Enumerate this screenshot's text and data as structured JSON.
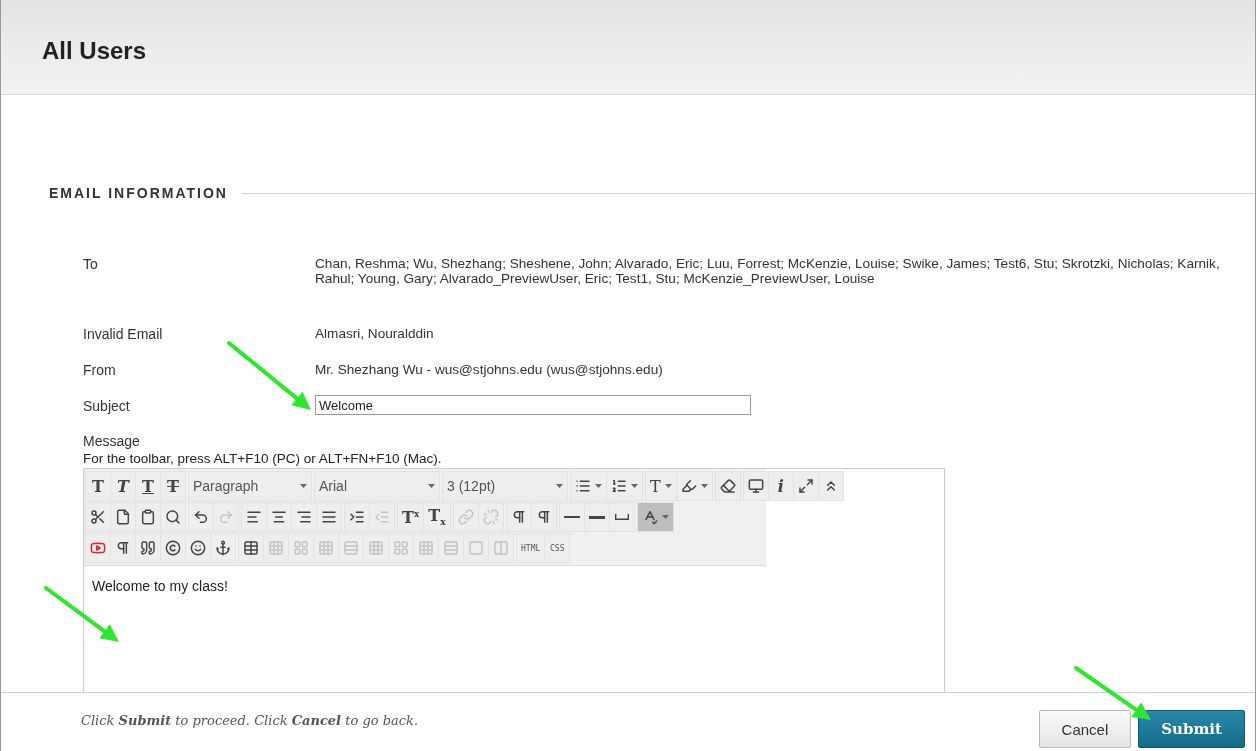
{
  "page": {
    "title": "All Users"
  },
  "section": {
    "title": "EMAIL INFORMATION"
  },
  "fields": [
    {
      "kind": "text",
      "label": "To",
      "value": "Chan, Reshma; Wu, Shezhang; Sheshene, John; Alvarado, Eric; Luu, Forrest; McKenzie, Louise; Swike, James; Test6, Stu; Skrotzki, Nicholas; Karnik, Rahul; Young, Gary; Alvarado_PreviewUser, Eric; Test1, Stu; McKenzie_PreviewUser, Louise"
    },
    {
      "kind": "text",
      "label": "Invalid Email",
      "value": "Almasri, Nouralddin"
    },
    {
      "kind": "text",
      "label": "From",
      "value": "Mr. Shezhang Wu - wus@stjohns.edu (wus@stjohns.edu)"
    },
    {
      "kind": "input",
      "label": "Subject",
      "value": "Welcome"
    }
  ],
  "message": {
    "label": "Message",
    "hint": "For the toolbar, press ALT+F10 (PC) or ALT+FN+F10 (Mac).",
    "body": "Welcome to my class!"
  },
  "toolbar": {
    "rows": [
      [
        {
          "items": [
            {
              "kind": "glyph",
              "label": "T",
              "disabled": false
            },
            {
              "kind": "glyph",
              "label": "T",
              "disabled": false
            },
            {
              "kind": "glyph",
              "label": "T",
              "disabled": false
            },
            {
              "kind": "glyph",
              "label": "T",
              "disabled": false
            }
          ]
        },
        {
          "items": [
            {
              "kind": "select",
              "label": "Paragraph"
            }
          ]
        },
        {
          "items": [
            {
              "kind": "select",
              "label": "Arial"
            }
          ]
        },
        {
          "items": [
            {
              "kind": "select",
              "label": "3 (12pt)"
            }
          ]
        },
        {
          "items": [
            {
              "kind": "split-icon",
              "disabled": false
            },
            {
              "kind": "split-icon",
              "disabled": false
            }
          ]
        },
        {
          "items": [
            {
              "kind": "split-glyph",
              "label": "T",
              "disabled": false
            },
            {
              "kind": "split-icon",
              "disabled": false
            }
          ]
        },
        {
          "items": [
            {
              "kind": "icon",
              "disabled": false
            }
          ]
        },
        {
          "items": [
            {
              "kind": "icon",
              "disabled": false
            },
            {
              "kind": "glyph",
              "label": "i",
              "disabled": false
            },
            {
              "kind": "icon",
              "disabled": false
            },
            {
              "kind": "icon",
              "disabled": false
            }
          ]
        }
      ],
      [
        {
          "items": [
            {
              "kind": "icon",
              "disabled": false
            },
            {
              "kind": "icon",
              "disabled": false
            },
            {
              "kind": "icon",
              "disabled": false
            },
            {
              "kind": "icon",
              "disabled": false
            }
          ]
        },
        {
          "items": [
            {
              "kind": "icon",
              "disabled": false
            },
            {
              "kind": "icon",
              "disabled": true
            }
          ]
        },
        {
          "items": [
            {
              "kind": "icon",
              "disabled": false
            },
            {
              "kind": "icon",
              "disabled": false
            },
            {
              "kind": "icon",
              "disabled": false
            },
            {
              "kind": "icon",
              "disabled": false
            }
          ]
        },
        {
          "items": [
            {
              "kind": "icon",
              "disabled": false
            },
            {
              "kind": "icon",
              "disabled": true
            }
          ]
        },
        {
          "items": [
            {
              "kind": "glyph",
              "label": "T$^{x}$",
              "disabled": false
            },
            {
              "kind": "glyph",
              "label": "T$_{x}$",
              "disabled": false
            }
          ]
        },
        {
          "items": [
            {
              "kind": "icon",
              "disabled": true
            },
            {
              "kind": "icon",
              "disabled": true
            }
          ]
        },
        {
          "items": [
            {
              "kind": "icon",
              "disabled": false
            },
            {
              "kind": "icon",
              "disabled": false
            }
          ]
        },
        {
          "items": [
            {
              "kind": "icon",
              "disabled": false
            },
            {
              "kind": "icon",
              "disabled": false
            },
            {
              "kind": "icon",
              "disabled": false
            }
          ]
        },
        {
          "items": [
            {
              "kind": "split-icon",
              "disabled": false,
              "pressed": true
            }
          ]
        }
      ],
      [
        {
          "items": [
            {
              "kind": "icon",
              "disabled": false
            },
            {
              "kind": "icon",
              "disabled": false
            },
            {
              "kind": "icon",
              "disabled": false
            },
            {
              "kind": "icon",
              "disabled": false
            },
            {
              "kind": "icon",
              "disabled": false
            },
            {
              "kind": "icon",
              "disabled": false
            }
          ]
        },
        {
          "items": [
            {
              "kind": "icon",
              "disabled": false
            },
            {
              "kind": "icon",
              "disabled": true
            },
            {
              "kind": "icon",
              "disabled": true
            },
            {
              "kind": "icon",
              "disabled": true
            },
            {
              "kind": "icon",
              "disabled": true
            },
            {
              "kind": "icon",
              "disabled": true
            },
            {
              "kind": "icon",
              "disabled": true
            },
            {
              "kind": "icon",
              "disabled": true
            },
            {
              "kind": "icon",
              "disabled": true
            },
            {
              "kind": "icon",
              "disabled": true
            },
            {
              "kind": "icon",
              "disabled": true
            }
          ]
        },
        {
          "items": [
            {
              "kind": "code",
              "label": "HTML"
            },
            {
              "kind": "code",
              "label": "CSS"
            }
          ]
        }
      ]
    ]
  },
  "footer": {
    "instructions": "Click **Submit** to proceed. Click **Cancel** to go back."
  },
  "buttons": [
    {
      "kind": "secondary",
      "label": "Cancel"
    },
    {
      "kind": "primary",
      "label": "Submit"
    }
  ]
}
